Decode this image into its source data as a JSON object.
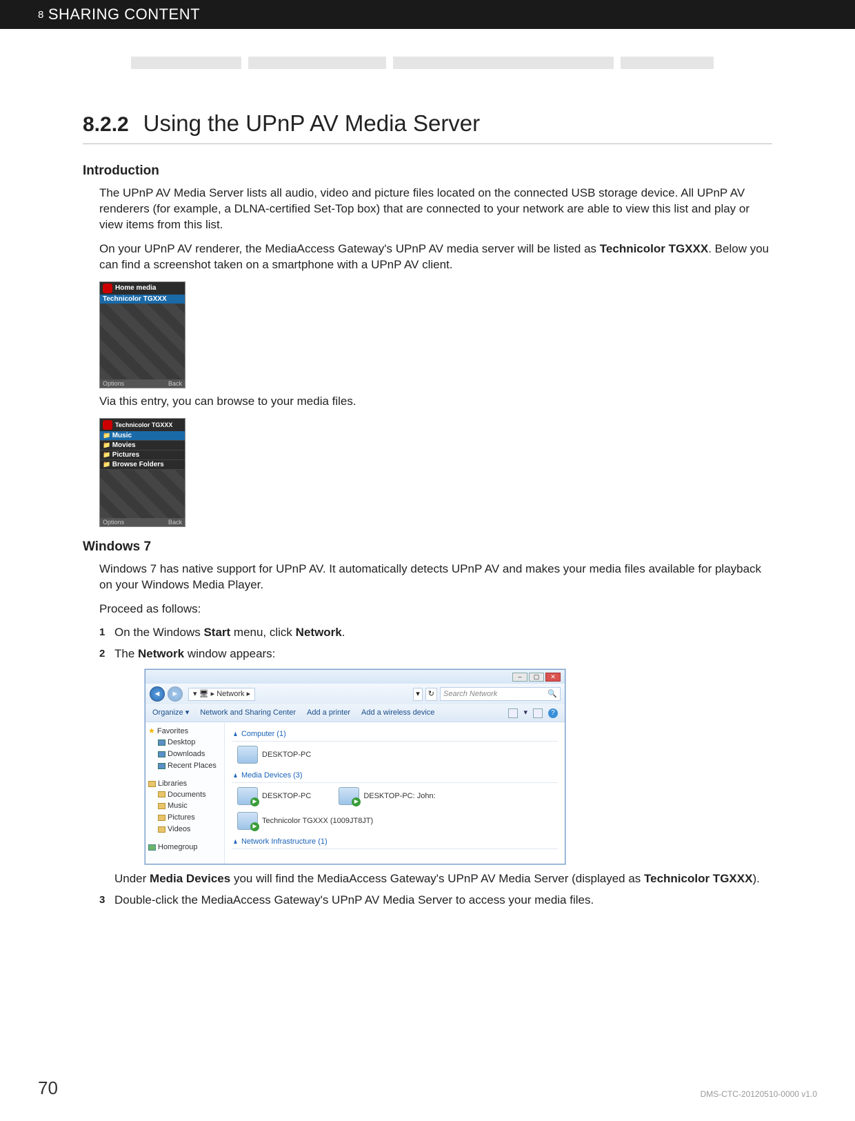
{
  "header": {
    "chapter_num": "8",
    "chapter_title": "SHARING CONTENT"
  },
  "section": {
    "number": "8.2.2",
    "title": "Using the UPnP AV Media Server"
  },
  "intro": {
    "heading": "Introduction",
    "p1_a": "The UPnP AV Media Server lists all audio, video and picture files located on the connected USB storage device. All UPnP AV renderers (for example, a DLNA-certified Set-Top box) that are connected to your network are able to view this list and play or view items from this list.",
    "p2_a": "On your UPnP AV renderer, the MediaAccess Gateway's UPnP AV media server will be listed as ",
    "p2_b": "Technicolor TGXXX",
    "p2_c": ". Below you can find a screenshot taken on a smartphone with a UPnP AV client.",
    "p3": "Via this entry, you can browse to your media files."
  },
  "phone1": {
    "title": "Home media",
    "selected": "Technicolor TGXXX",
    "options": "Options",
    "back": "Back"
  },
  "phone2": {
    "title": "Technicolor TGXXX",
    "items": [
      "Music",
      "Movies",
      "Pictures",
      "Browse Folders"
    ],
    "options": "Options",
    "back": "Back"
  },
  "win7section": {
    "heading": "Windows 7",
    "p1": "Windows 7 has native support for UPnP AV. It automatically detects UPnP AV and makes your media files available for playback on your Windows Media Player.",
    "p2": "Proceed as follows:",
    "step1_a": "On the Windows ",
    "step1_b": "Start",
    "step1_c": " menu, click ",
    "step1_d": "Network",
    "step1_e": ".",
    "step2_a": "The ",
    "step2_b": "Network",
    "step2_c": " window appears:",
    "step2_after_a": "Under ",
    "step2_after_b": "Media Devices",
    "step2_after_c": " you will find the MediaAccess Gateway's UPnP AV Media Server (displayed as ",
    "step2_after_d": "Technicolor TGXXX",
    "step2_after_e": ").",
    "step3": "Double-click the MediaAccess Gateway's UPnP AV Media Server to access your media files."
  },
  "win7shot": {
    "breadcrumb_icon": "🖥",
    "breadcrumb": "Network",
    "search_placeholder": "Search Network",
    "toolbar": {
      "organize": "Organize ▾",
      "nsc": "Network and Sharing Center",
      "printer": "Add a printer",
      "wireless": "Add a wireless device"
    },
    "sidebar": {
      "fav": "Favorites",
      "fav_items": [
        "Desktop",
        "Downloads",
        "Recent Places"
      ],
      "lib": "Libraries",
      "lib_items": [
        "Documents",
        "Music",
        "Pictures",
        "Videos"
      ],
      "hg": "Homegroup"
    },
    "categories": {
      "computer": "Computer (1)",
      "computer_items": [
        "DESKTOP-PC"
      ],
      "media": "Media Devices (3)",
      "media_items": [
        "DESKTOP-PC",
        "DESKTOP-PC: John:",
        "Technicolor TGXXX (1009JT8JT)"
      ],
      "infra": "Network Infrastructure (1)"
    }
  },
  "footer": {
    "page": "70",
    "docid": "DMS-CTC-20120510-0000 v1.0"
  }
}
